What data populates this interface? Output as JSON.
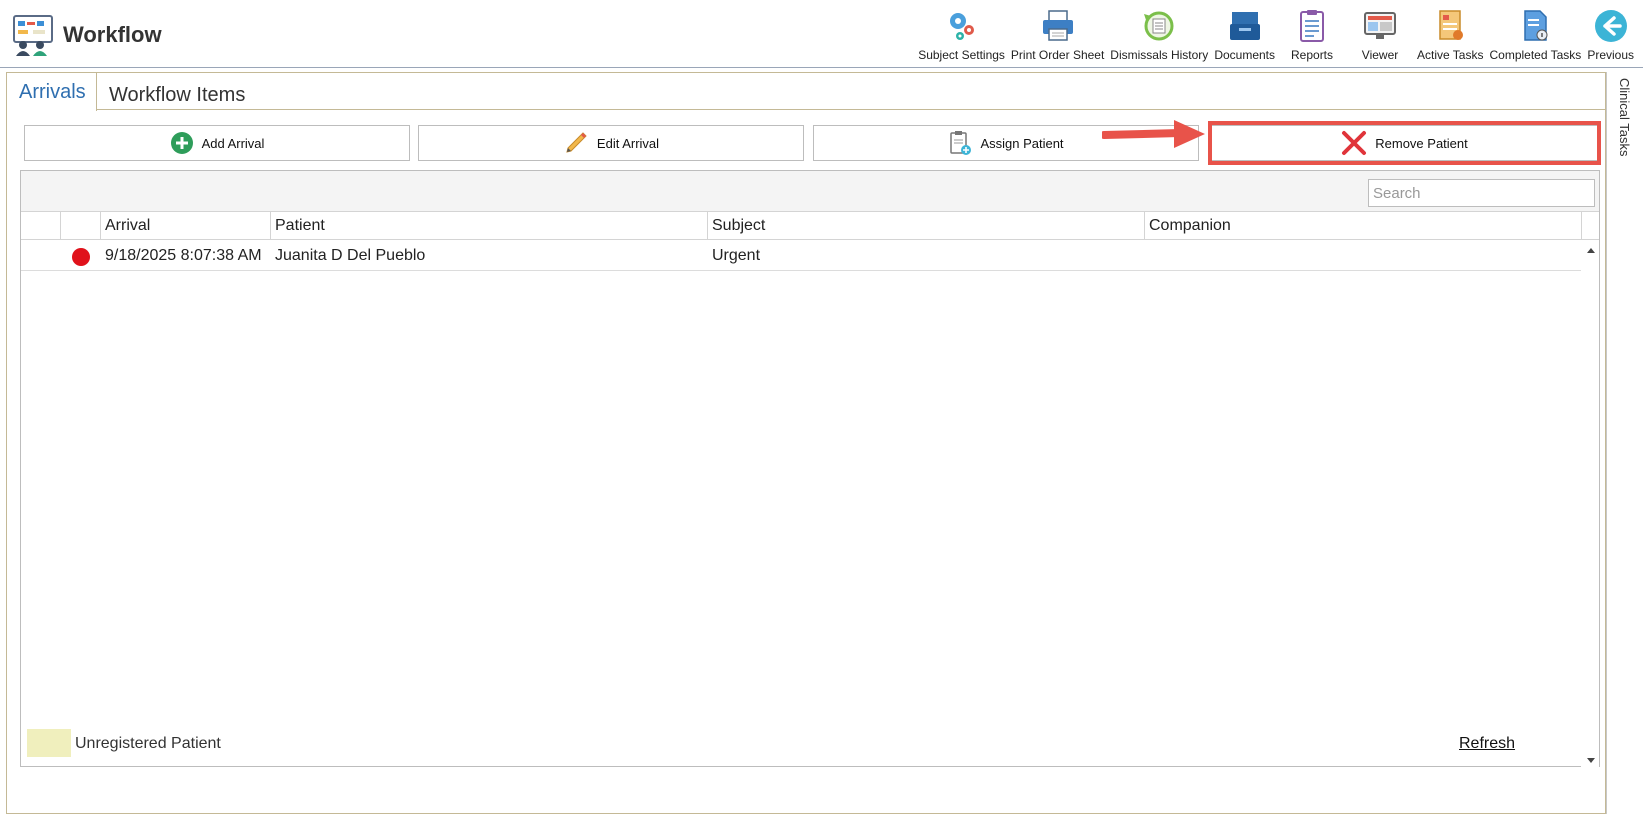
{
  "app": {
    "title": "Workflow",
    "logo_icon": "workflow-logo-icon"
  },
  "toolbar": {
    "items": [
      {
        "label": "Subject Settings",
        "icon": "gears-icon"
      },
      {
        "label": "Print Order Sheet",
        "icon": "printer-icon"
      },
      {
        "label": "Dismissals History",
        "icon": "history-icon"
      },
      {
        "label": "Documents",
        "icon": "document-tray-icon"
      },
      {
        "label": "Reports",
        "icon": "clipboard-icon"
      },
      {
        "label": "Viewer",
        "icon": "monitor-icon"
      },
      {
        "label": "Active Tasks",
        "icon": "active-tasks-icon"
      },
      {
        "label": "Completed Tasks",
        "icon": "completed-tasks-icon"
      },
      {
        "label": "Previous",
        "icon": "arrow-left-circle-icon"
      }
    ]
  },
  "side_panel": {
    "label": "Clinical Tasks"
  },
  "tabs": [
    {
      "label": "Arrivals",
      "active": true
    },
    {
      "label": "Workflow Items",
      "active": false
    }
  ],
  "actions": {
    "add_arrival": "Add Arrival",
    "edit_arrival": "Edit Arrival",
    "assign_patient": "Assign Patient",
    "remove_patient": "Remove Patient"
  },
  "search": {
    "placeholder": "Search",
    "value": ""
  },
  "grid": {
    "columns": [
      "",
      "",
      "Arrival",
      "Patient",
      "Subject",
      "Companion"
    ],
    "rows": [
      {
        "status_color": "#e0121b",
        "arrival": "9/18/2025 8:07:38 AM",
        "patient": "Juanita D Del Pueblo",
        "subject": "Urgent",
        "companion": ""
      }
    ]
  },
  "legend": {
    "label": "Unregistered Patient",
    "swatch_color": "#f0efbd"
  },
  "footer": {
    "refresh_label": "Refresh"
  },
  "colors": {
    "accent": "#2f6fb0",
    "highlight": "#e8534a",
    "status_red": "#e0121b"
  }
}
